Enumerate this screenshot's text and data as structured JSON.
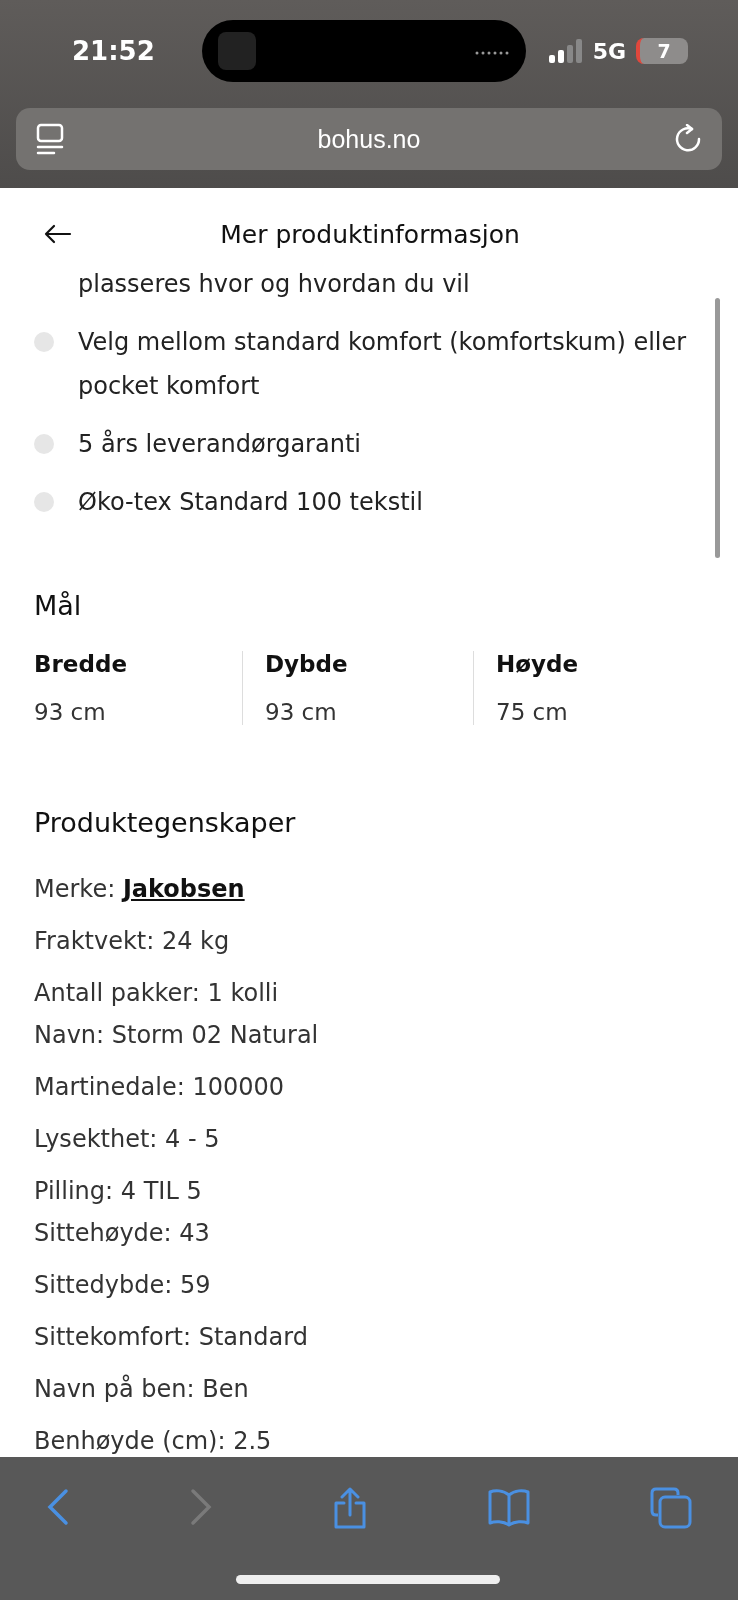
{
  "status_bar": {
    "time": "21:52",
    "network": "5G",
    "battery": "7"
  },
  "address_bar": {
    "url": "bohus.no"
  },
  "header": {
    "title": "Mer produktinformasjon"
  },
  "bullets": [
    "plasseres hvor og hvordan du vil",
    "Velg mellom standard komfort (komfortskum) eller pocket komfort",
    "5 års leverandørgaranti",
    "Øko-tex Standard 100 tekstil"
  ],
  "dimensions": {
    "title": "Mål",
    "items": [
      {
        "label": "Bredde",
        "value": "93 cm"
      },
      {
        "label": "Dybde",
        "value": "93 cm"
      },
      {
        "label": "Høyde",
        "value": "75 cm"
      }
    ]
  },
  "properties": {
    "title": "Produktegenskaper",
    "groups": [
      [
        {
          "label": "Merke:",
          "value": "Jakobsen",
          "kind": "link"
        }
      ],
      [
        {
          "label": "Fraktvekt: 24 kg",
          "kind": "text"
        }
      ],
      [
        {
          "label": "Antall pakker: 1 kolli",
          "kind": "text"
        },
        {
          "label": "Navn: Storm 02 Natural",
          "kind": "text"
        }
      ],
      [
        {
          "label": "Martinedale: 100000",
          "kind": "text"
        }
      ],
      [
        {
          "label": "Lysekthet: 4 - 5",
          "kind": "text"
        }
      ],
      [
        {
          "label": "Pilling: 4 TIL 5",
          "kind": "text"
        },
        {
          "label": "Sittehøyde: 43",
          "kind": "text"
        }
      ],
      [
        {
          "label": "Sittedybde: 59",
          "kind": "text"
        }
      ],
      [
        {
          "label": "Sittekomfort: Standard",
          "kind": "text"
        }
      ],
      [
        {
          "label": "Navn på ben: Ben",
          "kind": "text"
        }
      ],
      [
        {
          "label": "Benhøyde (cm): 2.5",
          "kind": "text"
        }
      ]
    ]
  },
  "toolbar": [
    {
      "kind": "back",
      "disabled": false
    },
    {
      "kind": "forward",
      "disabled": true
    },
    {
      "kind": "share",
      "disabled": false
    },
    {
      "kind": "bookmarks",
      "disabled": false
    },
    {
      "kind": "tabs",
      "disabled": false
    }
  ]
}
